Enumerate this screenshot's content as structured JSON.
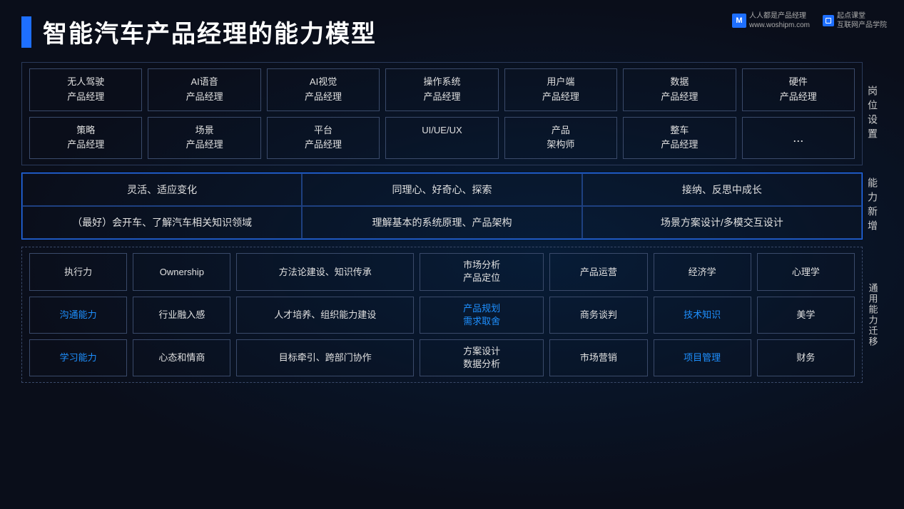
{
  "logos": {
    "left_text_line1": "人人都是产品经理",
    "left_text_line2": "www.woshipm.com",
    "right_label": "起点课堂",
    "right_sub": "互联网产品学院"
  },
  "header": {
    "title": "智能汽车产品经理的能力模型"
  },
  "section_positions": {
    "label": "岗位设置",
    "row1": [
      {
        "line1": "无人驾驶",
        "line2": "产品经理"
      },
      {
        "line1": "AI语音",
        "line2": "产品经理"
      },
      {
        "line1": "AI视觉",
        "line2": "产品经理"
      },
      {
        "line1": "操作系统",
        "line2": "产品经理"
      },
      {
        "line1": "用户端",
        "line2": "产品经理"
      },
      {
        "line1": "数据",
        "line2": "产品经理"
      },
      {
        "line1": "硬件",
        "line2": "产品经理"
      }
    ],
    "row2": [
      {
        "line1": "策略",
        "line2": "产品经理"
      },
      {
        "line1": "场景",
        "line2": "产品经理"
      },
      {
        "line1": "平台",
        "line2": "产品经理"
      },
      {
        "line1": "UI/UE/UX",
        "line2": ""
      },
      {
        "line1": "产品",
        "line2": "架构师"
      },
      {
        "line1": "整车",
        "line2": "产品经理"
      },
      {
        "line1": "...",
        "line2": ""
      }
    ]
  },
  "section_abilities": {
    "label": "能力新增",
    "row1": [
      {
        "text": "灵活、适应变化"
      },
      {
        "text": "同理心、好奇心、探索"
      },
      {
        "text": "接纳、反思中成长"
      }
    ],
    "row2": [
      {
        "text": "（最好）会开车、了解汽车相关知识领域"
      },
      {
        "text": "理解基本的系统原理、产品架构"
      },
      {
        "text": "场景方案设计/多模交互设计"
      }
    ]
  },
  "section_general": {
    "label": "通用能力迁移",
    "row1": [
      {
        "text": "执行力",
        "highlight": false
      },
      {
        "text": "Ownership",
        "highlight": false
      },
      {
        "text": "方法论建设、知识传承",
        "highlight": false
      },
      {
        "text": "市场分析\n产品定位",
        "highlight": false
      },
      {
        "text": "产品运营",
        "highlight": false
      },
      {
        "text": "经济学",
        "highlight": false
      },
      {
        "text": "心理学",
        "highlight": false
      }
    ],
    "row2": [
      {
        "text": "沟通能力",
        "highlight": true
      },
      {
        "text": "行业融入感",
        "highlight": false
      },
      {
        "text": "人才培养、组织能力建设",
        "highlight": false
      },
      {
        "text": "产品规划\n需求取舍",
        "highlight": true
      },
      {
        "text": "商务谈判",
        "highlight": false
      },
      {
        "text": "技术知识",
        "highlight": true
      },
      {
        "text": "美学",
        "highlight": false
      }
    ],
    "row3": [
      {
        "text": "学习能力",
        "highlight": true
      },
      {
        "text": "心态和情商",
        "highlight": false
      },
      {
        "text": "目标牵引、跨部门协作",
        "highlight": false
      },
      {
        "text": "方案设计\n数据分析",
        "highlight": false
      },
      {
        "text": "市场营销",
        "highlight": false
      },
      {
        "text": "项目管理",
        "highlight": true
      },
      {
        "text": "财务",
        "highlight": false
      }
    ]
  }
}
